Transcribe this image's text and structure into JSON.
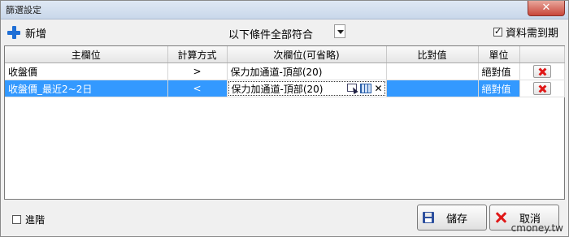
{
  "window": {
    "title": "篩選設定",
    "close_glyph": "✕"
  },
  "toolbar": {
    "new_label": "新增",
    "condition": "以下條件全部符合",
    "need_expiry_label": "資料需到期",
    "need_expiry_checked": true
  },
  "table": {
    "headers": [
      "主欄位",
      "計算方式",
      "次欄位(可省略)",
      "比對值",
      "單位",
      ""
    ],
    "rows": [
      {
        "main": "收盤價",
        "op": ">",
        "secondary": "保力加通道-頂部(20)",
        "compare": "",
        "unit": "絕對值",
        "selected": false
      },
      {
        "main": "收盤價_最近2~2日",
        "op": "<",
        "secondary": "保力加通道-頂部(20)",
        "compare": "",
        "unit": "絕對值",
        "selected": true
      }
    ]
  },
  "footer": {
    "advanced_label": "進階",
    "advanced_checked": false,
    "save_label": "儲存",
    "cancel_label": "取消"
  },
  "watermark": "cmoney.tw",
  "colors": {
    "selection": "#3399ff",
    "delete_x": "#e01818",
    "plus_icon": "#1f6fd6"
  }
}
